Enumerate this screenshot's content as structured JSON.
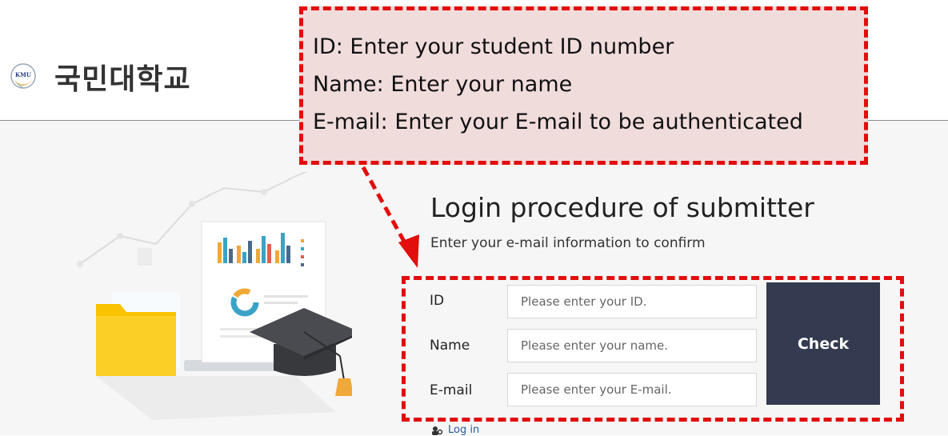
{
  "header": {
    "university_name": "국민대학교",
    "logo_text": "KMU"
  },
  "callout": {
    "lines": [
      "ID: Enter your student ID number",
      "Name: Enter your name",
      "E-mail: Enter your E-mail to be authenticated"
    ],
    "border_color": "#e20d0d",
    "background": "#f1dcdc"
  },
  "login": {
    "title": "Login procedure of submitter",
    "subtitle": "Enter your e-mail information to confirm",
    "fields": [
      {
        "label": "ID",
        "placeholder": "Please enter your ID."
      },
      {
        "label": "Name",
        "placeholder": "Please enter your name."
      },
      {
        "label": "E-mail",
        "placeholder": "Please enter your E-mail."
      }
    ],
    "check_label": "Check",
    "check_color": "#343a4f",
    "login_link": "Log in"
  },
  "icons": [
    "kmu-logo-icon",
    "folder-icon",
    "graduation-cap-icon",
    "document-chart-icon",
    "user-key-icon"
  ]
}
